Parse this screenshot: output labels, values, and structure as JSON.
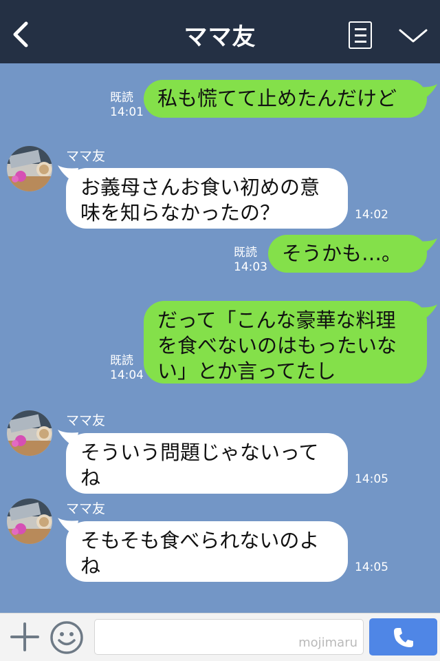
{
  "header": {
    "title": "ママ友"
  },
  "messages": [
    {
      "text": "私も慌てて止めたんだけど",
      "read": "既読",
      "time": "14:01"
    },
    {
      "sender": "ママ友",
      "text": "お義母さんお食い初めの意味を知らなかったの？",
      "time": "14:02"
    },
    {
      "text": "そうかも…。",
      "read": "既読",
      "time": "14:03"
    },
    {
      "text": "だって「こんな豪華な料理を食べないのはもったいない」とか言ってたし",
      "read": "既読",
      "time": "14:04"
    },
    {
      "sender": "ママ友",
      "text": "そういう問題じゃないってね",
      "time": "14:05"
    },
    {
      "sender": "ママ友",
      "text": "そもそも食べられないのよね",
      "time": "14:05"
    }
  ],
  "footer": {
    "watermark": "mojimaru",
    "input_value": ""
  },
  "icons": [
    "back-icon",
    "menu-icon",
    "chevron-down-icon",
    "plus-icon",
    "smile-icon",
    "phone-icon"
  ],
  "colors": {
    "header": "#243044",
    "chat_bg": "#7396c6",
    "outgoing": "#84e04a",
    "incoming": "#ffffff",
    "send": "#4f86e6"
  }
}
